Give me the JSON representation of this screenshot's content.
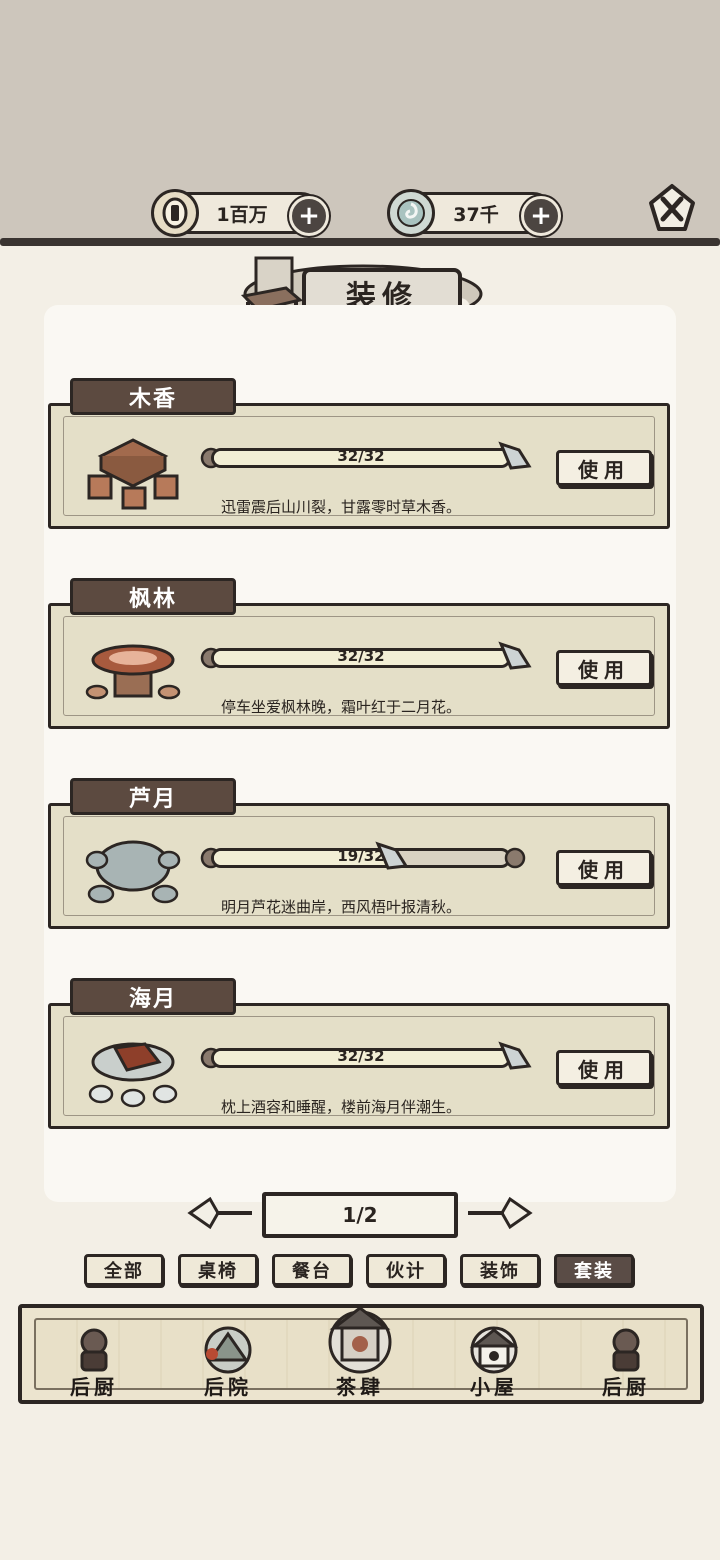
{
  "header": {
    "coins": "1百万",
    "jade": "37千",
    "title": "装修"
  },
  "cards": [
    {
      "tab": "木香",
      "progress_text": "32/32",
      "progress": 1.0,
      "desc": "迅雷震后山川裂，甘露零时草木香。",
      "button": "使用",
      "icon": "wooden-table-set-icon"
    },
    {
      "tab": "枫林",
      "progress_text": "32/32",
      "progress": 1.0,
      "desc": "停车坐爱枫林晚，霜叶红于二月花。",
      "button": "使用",
      "icon": "mushroom-stump-table-icon"
    },
    {
      "tab": "芦月",
      "progress_text": "19/32",
      "progress": 0.59,
      "desc": "明月芦花迷曲岸，西风梧叶报清秋。",
      "button": "使用",
      "icon": "stone-table-icon"
    },
    {
      "tab": "海月",
      "progress_text": "32/32",
      "progress": 1.0,
      "desc": "枕上酒容和睡醒，楼前海月伴潮生。",
      "button": "使用",
      "icon": "round-table-drums-icon"
    }
  ],
  "pager": {
    "label": "1/2"
  },
  "filters": [
    "全部",
    "桌椅",
    "餐台",
    "伙计",
    "装饰",
    "套装"
  ],
  "active_filter": "套装",
  "nav": [
    {
      "label": "后厨",
      "icon": "chef-icon"
    },
    {
      "label": "后院",
      "icon": "backyard-icon"
    },
    {
      "label": "茶肆",
      "icon": "teahouse-icon"
    },
    {
      "label": "小屋",
      "icon": "cottage-icon"
    },
    {
      "label": "后厨",
      "icon": "chef-icon"
    }
  ],
  "colors": {
    "accent_dark": "#5c4a40",
    "card_bg": "#e4dfc8",
    "ink": "#2c2623"
  }
}
